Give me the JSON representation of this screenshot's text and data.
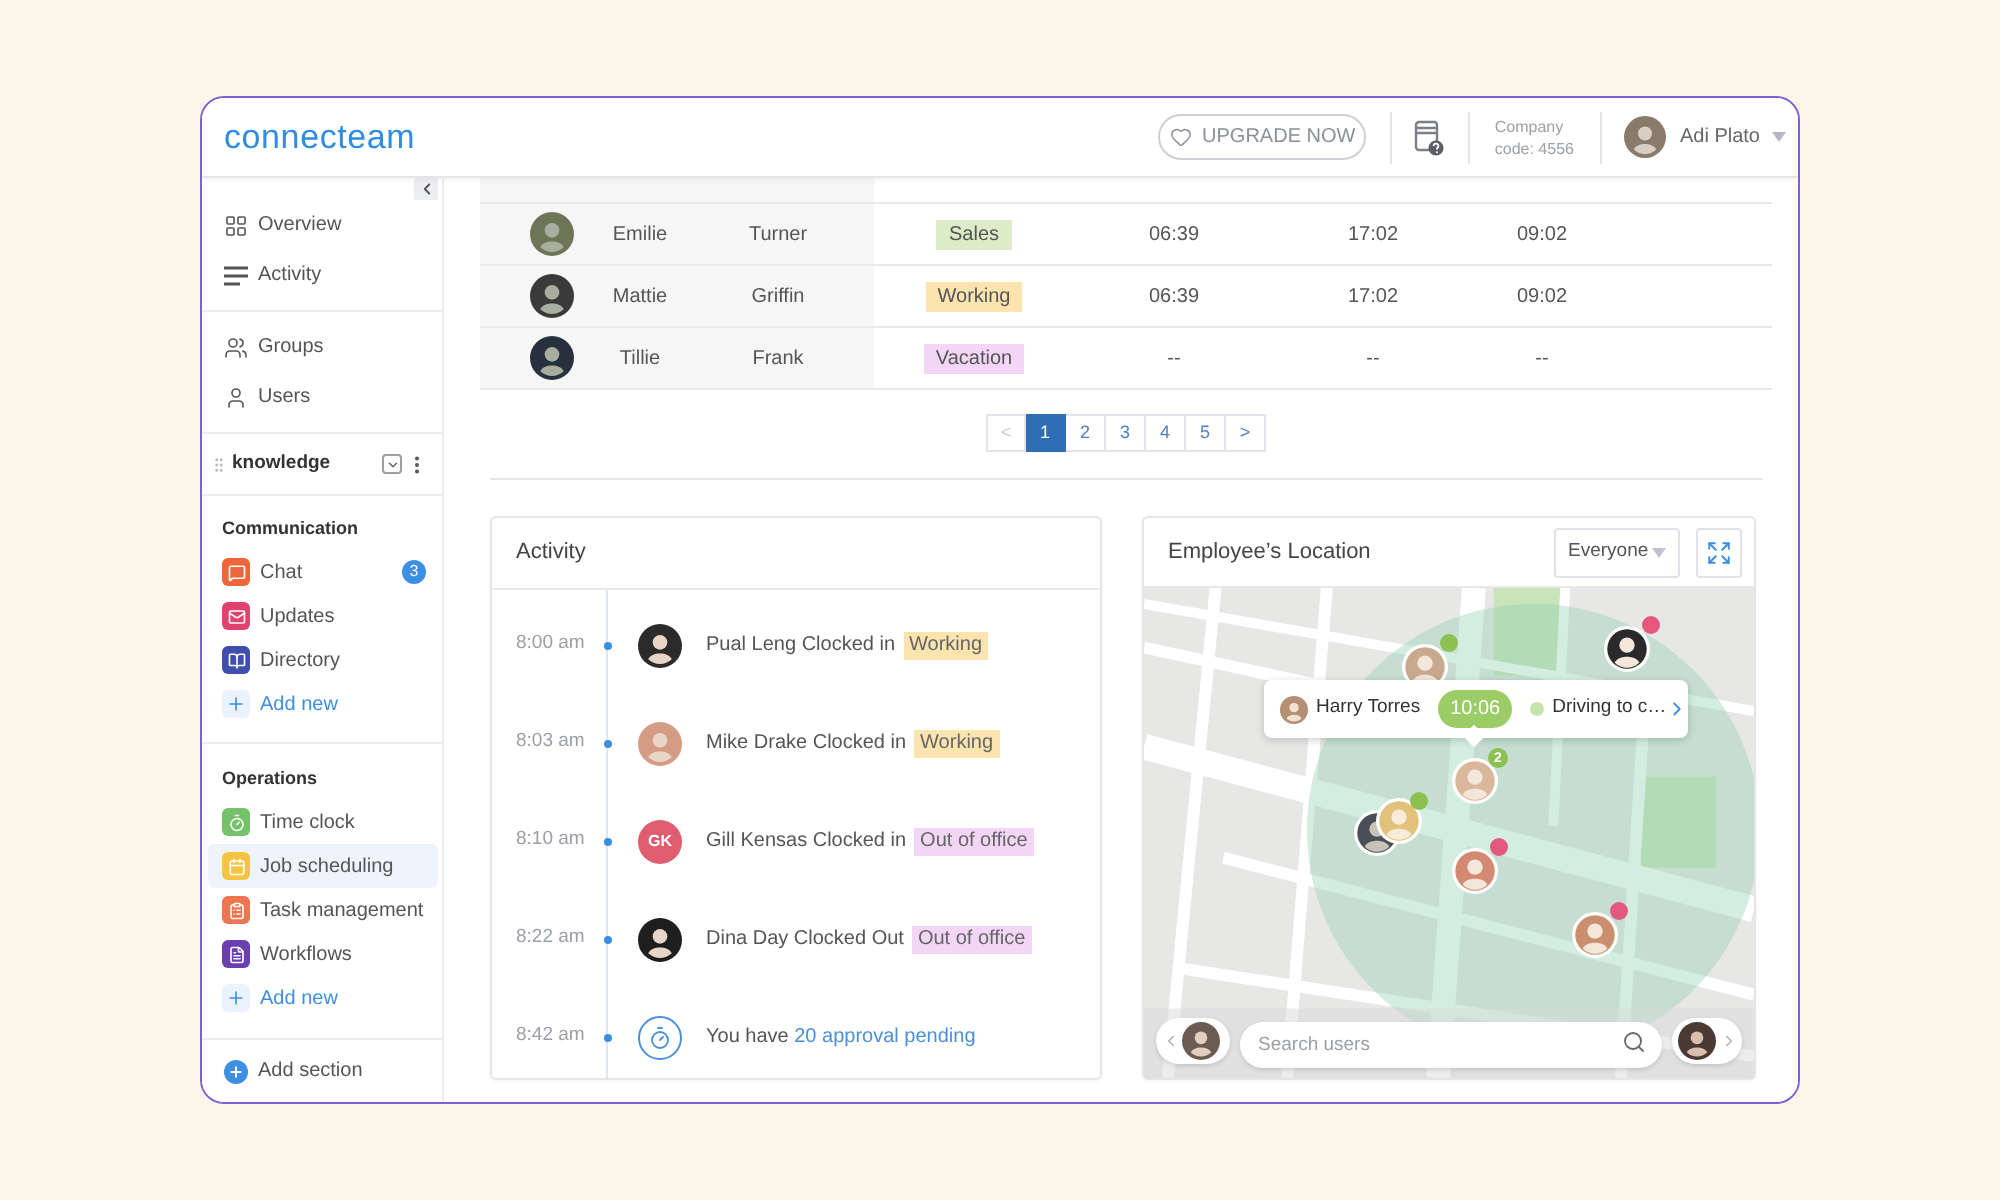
{
  "header": {
    "logo": "connecteam",
    "upgrade_button": "UPGRADE NOW",
    "company_label": "Company",
    "company_code": "code: 4556",
    "user_name": "Adi Plato"
  },
  "sidebar": {
    "groups": [
      {
        "items": [
          {
            "label": "Overview",
            "selected": false
          },
          {
            "label": "Activity",
            "selected": false
          }
        ]
      },
      {
        "items": [
          {
            "label": "Groups",
            "selected": false
          },
          {
            "label": "Users",
            "selected": false
          }
        ]
      }
    ],
    "knowledge": {
      "label": "knowledge"
    },
    "sections": [
      {
        "title": "Communication",
        "items": [
          {
            "label": "Chat",
            "color": "#f0663b",
            "badge": "3",
            "selected": false
          },
          {
            "label": "Updates",
            "color": "#e2436e",
            "selected": false
          },
          {
            "label": "Directory",
            "color": "#3e4fae",
            "selected": false
          }
        ],
        "add_new": "Add new"
      },
      {
        "title": "Operations",
        "items": [
          {
            "label": "Time clock",
            "color": "#76c26a",
            "selected": false
          },
          {
            "label": "Job scheduling",
            "color": "#f6c343",
            "selected": true
          },
          {
            "label": "Task management",
            "color": "#ef7550",
            "selected": false
          },
          {
            "label": "Workflows",
            "color": "#6b3fb0",
            "selected": false
          }
        ],
        "add_new": "Add new"
      }
    ],
    "add_section": "Add section"
  },
  "table": {
    "rows": [
      {
        "first_name": "Emilie",
        "last_name": "Turner",
        "status": {
          "text": "Sales",
          "color": "#dcecc8"
        },
        "start": "06:39",
        "end": "17:02",
        "total": "09:02"
      },
      {
        "first_name": "Mattie",
        "last_name": "Griffin",
        "status": {
          "text": "Working",
          "color": "#fbe4ae"
        },
        "start": "06:39",
        "end": "17:02",
        "total": "09:02"
      },
      {
        "first_name": "Tillie",
        "last_name": "Frank",
        "status": {
          "text": "Vacation",
          "color": "#f3d6f6"
        },
        "start": "--",
        "end": "--",
        "total": "--"
      }
    ],
    "pagination": {
      "previous": {
        "label": "<",
        "disabled": true
      },
      "pages": [
        {
          "label": "1",
          "selected": true
        },
        {
          "label": "2",
          "selected": false
        },
        {
          "label": "3",
          "selected": false
        },
        {
          "label": "4",
          "selected": false
        },
        {
          "label": "5",
          "selected": false
        }
      ],
      "next": {
        "label": ">",
        "disabled": false
      }
    }
  },
  "activity": {
    "title": "Activity",
    "items": [
      {
        "time": "8:00 am",
        "kind": "photo",
        "text": "Pual Leng Clocked in",
        "status": {
          "text": "Working",
          "color": "#fbe4ae"
        }
      },
      {
        "time": "8:03 am",
        "kind": "photo",
        "text": "Mike Drake Clocked in",
        "status": {
          "text": "Working",
          "color": "#fbe4ae"
        }
      },
      {
        "time": "8:10 am",
        "kind": "initials",
        "initials": "GK",
        "text": "Gill Kensas Clocked in",
        "status": {
          "text": "Out of office",
          "color": "#f3d6f6"
        }
      },
      {
        "time": "8:22 am",
        "kind": "photo",
        "text": "Dina Day Clocked Out",
        "status": {
          "text": "Out of office",
          "color": "#f3d6f6"
        }
      },
      {
        "time": "8:42 am",
        "kind": "approval",
        "text": "You have",
        "link": "20 approval pending"
      }
    ]
  },
  "location": {
    "title": "Employee’s Location",
    "filter": {
      "value": "Everyone"
    },
    "popup": {
      "name": "Harry Torres",
      "time": "10:06",
      "status": "Driving to c…"
    },
    "markers": [
      {
        "kind": "single",
        "color": "#8cc152"
      },
      {
        "kind": "single",
        "color": "#e5587d"
      },
      {
        "kind": "cluster",
        "color": "#8cc152",
        "count": "2"
      },
      {
        "kind": "stack",
        "color": "#8cc152"
      },
      {
        "kind": "single",
        "color": "#e5587d"
      },
      {
        "kind": "single",
        "color": "#e5587d"
      }
    ],
    "search": {
      "placeholder": "Search users"
    }
  }
}
